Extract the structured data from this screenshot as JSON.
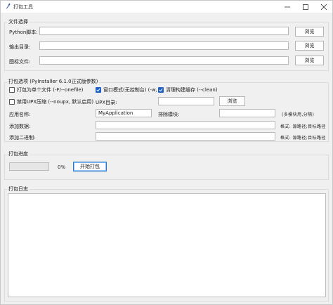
{
  "window": {
    "title": "打包工具"
  },
  "file_section": {
    "title": "文件选择",
    "rows": [
      {
        "label": "Python脚本:",
        "value": "",
        "browse": "浏览"
      },
      {
        "label": "输出目录:",
        "value": "",
        "browse": "浏览"
      },
      {
        "label": "图标文件:",
        "value": "",
        "browse": "浏览"
      }
    ]
  },
  "options_section": {
    "title": "打包选项 (PyInstaller 6.1.0正式版参数)",
    "onefile": {
      "label": "打包为单个文件 (-F/--onefile)",
      "checked": false
    },
    "windowed": {
      "label": "窗口模式(无控制台) (-w,",
      "checked": true
    },
    "clean": {
      "label": "清理构建缓存 (--clean)",
      "checked": true
    },
    "noupx": {
      "label": "禁用UPX压缩 (--noupx, 默认启用)",
      "checked": false
    },
    "upx_dir": {
      "label": "UPX目录:",
      "value": "",
      "browse": "浏览"
    },
    "app_name": {
      "label": "应用名称:",
      "value": "MyApplication"
    },
    "exclude": {
      "label": "排除模块:",
      "value": "",
      "hint": "(多模块用,分隔)"
    },
    "add_data": {
      "label": "添加数据:",
      "value": "",
      "hint": "格式: 源路径;目标路径"
    },
    "add_binary": {
      "label": "添加二进制:",
      "value": "",
      "hint": "格式: 源路径;目标路径"
    }
  },
  "progress_section": {
    "title": "打包进度",
    "progress": 0,
    "percent_text": "0%",
    "start_button": "开始打包"
  },
  "log_section": {
    "title": "打包日志",
    "content": ""
  }
}
